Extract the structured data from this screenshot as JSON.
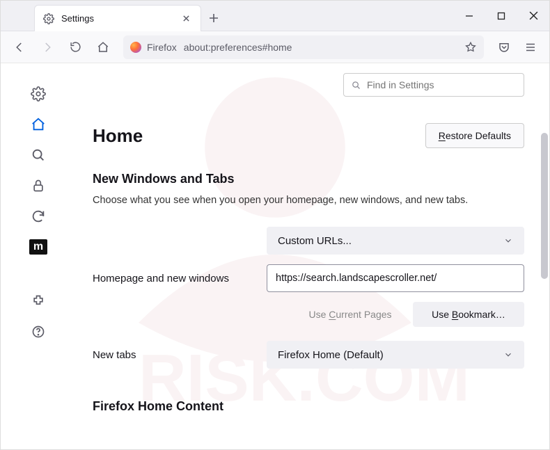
{
  "titlebar": {
    "tab_title": "Settings"
  },
  "toolbar": {
    "identity_label": "Firefox",
    "url": "about:preferences#home"
  },
  "search": {
    "placeholder": "Find in Settings"
  },
  "header": {
    "title": "Home",
    "restore": "Restore Defaults",
    "restore_u": "R"
  },
  "section1": {
    "title": "New Windows and Tabs",
    "desc": "Choose what you see when you open your homepage, new windows, and new tabs."
  },
  "form": {
    "homepage_label": "Homepage and new windows",
    "homepage_select": "Custom URLs...",
    "homepage_url": "https://search.landscapescroller.net/",
    "use_current": "Use Current Pages",
    "use_current_u": "C",
    "use_bookmark": "Use Bookmark…",
    "use_bookmark_u": "B",
    "newtabs_label": "New tabs",
    "newtabs_select": "Firefox Home (Default)"
  },
  "section2": {
    "title": "Firefox Home Content"
  }
}
